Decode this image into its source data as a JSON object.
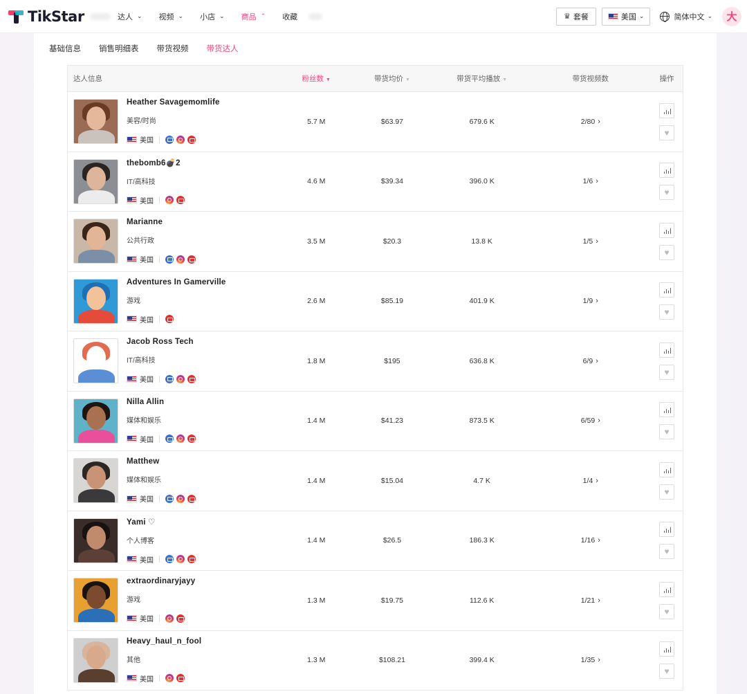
{
  "brand": {
    "name": "TikStar"
  },
  "nav": {
    "items": [
      {
        "label": "达人",
        "chevron": "⌄"
      },
      {
        "label": "视频",
        "chevron": "⌄"
      },
      {
        "label": "小店",
        "chevron": "⌄"
      },
      {
        "label": "商品",
        "chevron": "⌃",
        "active": true
      },
      {
        "label": "收藏"
      }
    ],
    "plan_label": "套餐",
    "region_label": "美国",
    "language_label": "简体中文",
    "user_initial": "大"
  },
  "subtabs": [
    {
      "label": "基础信息"
    },
    {
      "label": "销售明细表"
    },
    {
      "label": "带货视频"
    },
    {
      "label": "带货达人",
      "active": true
    }
  ],
  "table": {
    "headers": {
      "info": "达人信息",
      "fans": "粉丝数",
      "avg_price": "带货均价",
      "avg_plays": "带货平均播放",
      "video_count": "带货视频数",
      "ops": "操作"
    },
    "sort_caret": "▼",
    "country_label": "美国",
    "video_arrow": "›",
    "rows": [
      {
        "name": "Heather Savagemomlife",
        "category": "美容/时尚",
        "fans": "5.7 M",
        "avg_price": "$63.97",
        "avg_plays": "679.6 K",
        "videos": "2/80",
        "socials": [
          "mail",
          "ig",
          "yt"
        ],
        "avatar": {
          "bg": "#9a6b55",
          "hair": "#6b3a22",
          "skin": "#e5b89b",
          "body": "#c9c2bd"
        }
      },
      {
        "name": "thebomb6💣2",
        "category": "IT/高科技",
        "fans": "4.6 M",
        "avg_price": "$39.34",
        "avg_plays": "396.0 K",
        "videos": "1/6",
        "socials": [
          "ig",
          "yt"
        ],
        "avatar": {
          "bg": "#8b8f93",
          "hair": "#2a2422",
          "skin": "#dcb59a",
          "body": "#ececec"
        }
      },
      {
        "name": "Marianne",
        "category": "公共行政",
        "fans": "3.5 M",
        "avg_price": "$20.3",
        "avg_plays": "13.8 K",
        "videos": "1/5",
        "socials": [
          "mail",
          "ig",
          "yt"
        ],
        "avatar": {
          "bg": "#c9b7a8",
          "hair": "#3b2418",
          "skin": "#e2b597",
          "body": "#7b8fa6"
        }
      },
      {
        "name": "Adventures In Gamerville",
        "category": "游戏",
        "fans": "2.6 M",
        "avg_price": "$85.19",
        "avg_plays": "401.9 K",
        "videos": "1/9",
        "socials": [
          "yt"
        ],
        "avatar": {
          "bg": "#2f9ad6",
          "hair": "#1f6fb5",
          "skin": "#f2c29b",
          "body": "#e44b3a"
        }
      },
      {
        "name": "Jacob Ross Tech",
        "category": "IT/高科技",
        "fans": "1.8 M",
        "avg_price": "$195",
        "avg_plays": "636.8 K",
        "videos": "6/9",
        "socials": [
          "mail",
          "ig",
          "yt"
        ],
        "avatar": {
          "bg": "#ffffff",
          "hair": "#e36b4f",
          "skin": "#ffffff",
          "body": "#5a8fd6"
        }
      },
      {
        "name": "Nilla Allin",
        "category": "媒体和娱乐",
        "fans": "1.4 M",
        "avg_price": "$41.23",
        "avg_plays": "873.5 K",
        "videos": "6/59",
        "socials": [
          "mail",
          "ig",
          "yt"
        ],
        "avatar": {
          "bg": "#5fb3c9",
          "hair": "#1e1512",
          "skin": "#a9714f",
          "body": "#ea4f9c"
        }
      },
      {
        "name": "Matthew",
        "category": "媒体和娱乐",
        "fans": "1.4 M",
        "avg_price": "$15.04",
        "avg_plays": "4.7 K",
        "videos": "1/4",
        "socials": [
          "mail",
          "ig",
          "yt"
        ],
        "avatar": {
          "bg": "#d8d6d2",
          "hair": "#2d2724",
          "skin": "#c99376",
          "body": "#3a3a3c"
        }
      },
      {
        "name": "Yami ♡",
        "category": "个人博客",
        "fans": "1.4 M",
        "avg_price": "$26.5",
        "avg_plays": "186.3 K",
        "videos": "1/16",
        "socials": [
          "mail",
          "ig",
          "yt"
        ],
        "avatar": {
          "bg": "#3a2c28",
          "hair": "#191210",
          "skin": "#c08a6c",
          "body": "#5c4038"
        }
      },
      {
        "name": "extraordinaryjayy",
        "category": "游戏",
        "fans": "1.3 M",
        "avg_price": "$19.75",
        "avg_plays": "112.6 K",
        "videos": "1/21",
        "socials": [
          "ig",
          "yt"
        ],
        "avatar": {
          "bg": "#e8a030",
          "hair": "#1a120e",
          "skin": "#7c4b2e",
          "body": "#2a6fb8"
        }
      },
      {
        "name": "Heavy_haul_n_fool",
        "category": "其他",
        "fans": "1.3 M",
        "avg_price": "$108.21",
        "avg_plays": "399.4 K",
        "videos": "1/35",
        "socials": [
          "ig",
          "yt"
        ],
        "avatar": {
          "bg": "#cfcfcf",
          "hair": "#d7b49a",
          "skin": "#d9a98c",
          "body": "#5a3e2e"
        }
      }
    ]
  },
  "colors": {
    "accent": "#f5457c",
    "mail": "#3b6fd6",
    "youtube": "#e62e2e"
  },
  "icons": {
    "plan": "crown-icon",
    "region": "us-flag-icon",
    "language": "globe-icon",
    "row_chart": "chart-icon",
    "row_favorite": "heart-icon"
  }
}
